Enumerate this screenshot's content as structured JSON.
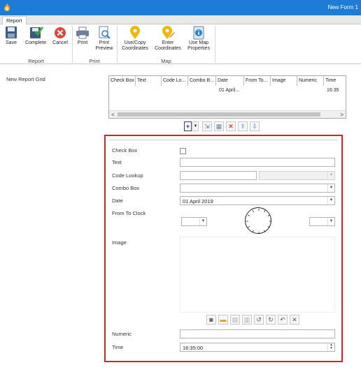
{
  "window": {
    "title": "New Form 1"
  },
  "ribbon": {
    "tab": "Report",
    "buttons": {
      "save": "Save",
      "complete": "Complete",
      "cancel": "Cancel",
      "print": "Print",
      "print_preview_l1": "Print",
      "print_preview_l2": "Preview",
      "use_copy_l1": "Use/Copy",
      "use_copy_l2": "Coordinates",
      "enter_l1": "Enter",
      "enter_l2": "Coordinates",
      "map_props_l1": "Use Map",
      "map_props_l2": "Properties"
    },
    "groups": {
      "report": "Report",
      "print": "Print",
      "map": "Map"
    }
  },
  "grid": {
    "label": "New Report Grid",
    "columns": [
      "Check Box",
      "Text",
      "Code Lo...",
      "Combo B...",
      "Date",
      "From To...",
      "Image",
      "Numeric",
      "Time"
    ],
    "row": {
      "date": "01 April...",
      "time": "16:35"
    }
  },
  "form": {
    "labels": {
      "check_box": "Check Box",
      "text": "Text",
      "code_lookup": "Code Lookup",
      "combo_box": "Combo Box",
      "date": "Date",
      "from_to_clock": "From To Clock",
      "image": "Image",
      "numeric": "Numeric",
      "time": "Time"
    },
    "values": {
      "text": "",
      "code_lookup": "",
      "combo_box": "",
      "date": "01 April 2019",
      "numeric": "",
      "time": "16:35:00"
    }
  },
  "icons": {
    "save": "save-icon",
    "complete": "complete-icon",
    "cancel": "cancel-icon",
    "print": "printer-icon",
    "preview": "print-preview-icon",
    "coordinates": "pin-icon",
    "enter_coordinates": "pin-edit-icon",
    "map_properties": "info-icon"
  },
  "colors": {
    "titlebar": "#1e7bd6",
    "highlight_border": "#e02020"
  }
}
